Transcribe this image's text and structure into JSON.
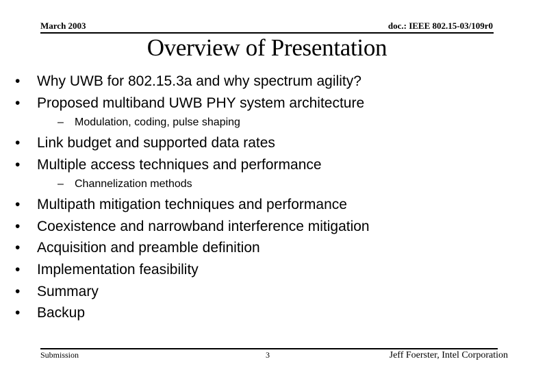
{
  "header": {
    "date": "March 2003",
    "doc_id": "doc.: IEEE 802.15-03/109r0"
  },
  "slide": {
    "title": "Overview of Presentation",
    "bullet_glyph": "•",
    "dash_glyph": "–",
    "bullets": [
      {
        "text": "Why UWB for 802.15.3a and why spectrum agility?"
      },
      {
        "text": "Proposed multiband UWB PHY system architecture",
        "sub": "Modulation, coding, pulse shaping"
      },
      {
        "text": "Link budget and supported data rates"
      },
      {
        "text": "Multiple access techniques and performance",
        "sub": "Channelization methods"
      },
      {
        "text": "Multipath mitigation techniques and performance"
      },
      {
        "text": "Coexistence and narrowband interference mitigation"
      },
      {
        "text": "Acquisition and preamble definition"
      },
      {
        "text": "Implementation feasibility"
      },
      {
        "text": "Summary"
      },
      {
        "text": "Backup"
      }
    ]
  },
  "footer": {
    "left": "Submission",
    "page_number": "3",
    "author": "Jeff Foerster, Intel Corporation"
  }
}
